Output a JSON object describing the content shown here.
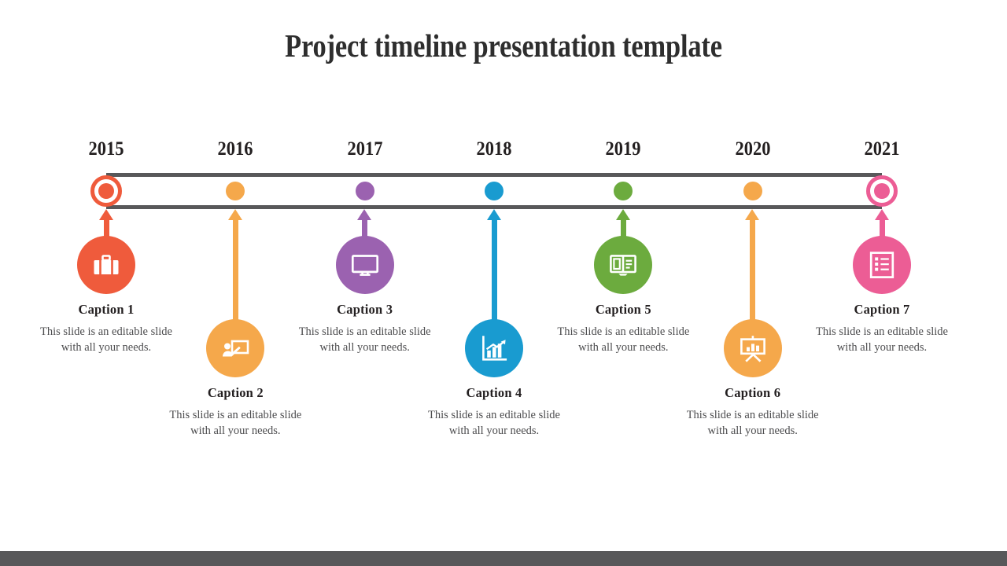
{
  "slide": {
    "title": "Project timeline presentation template",
    "background_color": "#ffffff",
    "rail_color": "#58585a",
    "bottom_bar_color": "#58585a"
  },
  "timeline": {
    "items": [
      {
        "year": "2015",
        "caption_title": "Caption 1",
        "caption_body": "This slide is an editable slide with all your needs.",
        "color": "#ef5b3c",
        "icon": "briefcase-icon",
        "position": "above",
        "dot_style": "ringed"
      },
      {
        "year": "2016",
        "caption_title": "Caption 2",
        "caption_body": "This slide is an editable slide with all your needs.",
        "color": "#f5a84b",
        "icon": "presenter-board-icon",
        "position": "below",
        "dot_style": "solid"
      },
      {
        "year": "2017",
        "caption_title": "Caption 3",
        "caption_body": "This slide is an editable slide with all your needs.",
        "color": "#9b62b0",
        "icon": "monitor-icon",
        "position": "above",
        "dot_style": "solid"
      },
      {
        "year": "2018",
        "caption_title": "Caption 4",
        "caption_body": "This slide is an editable slide with all your needs.",
        "color": "#199bd0",
        "icon": "bar-chart-growth-icon",
        "position": "below",
        "dot_style": "solid"
      },
      {
        "year": "2019",
        "caption_title": "Caption 5",
        "caption_body": "This slide is an editable slide with all your needs.",
        "color": "#6cab3e",
        "icon": "open-book-icon",
        "position": "above",
        "dot_style": "solid"
      },
      {
        "year": "2020",
        "caption_title": "Caption 6",
        "caption_body": "This slide is an editable slide with all your needs.",
        "color": "#f5a84b",
        "icon": "presentation-easel-icon",
        "position": "below",
        "dot_style": "solid"
      },
      {
        "year": "2021",
        "caption_title": "Caption 7",
        "caption_body": "This slide is an editable slide with all your needs.",
        "color": "#ec5d95",
        "icon": "checklist-document-icon",
        "position": "above",
        "dot_style": "ringed"
      }
    ]
  }
}
